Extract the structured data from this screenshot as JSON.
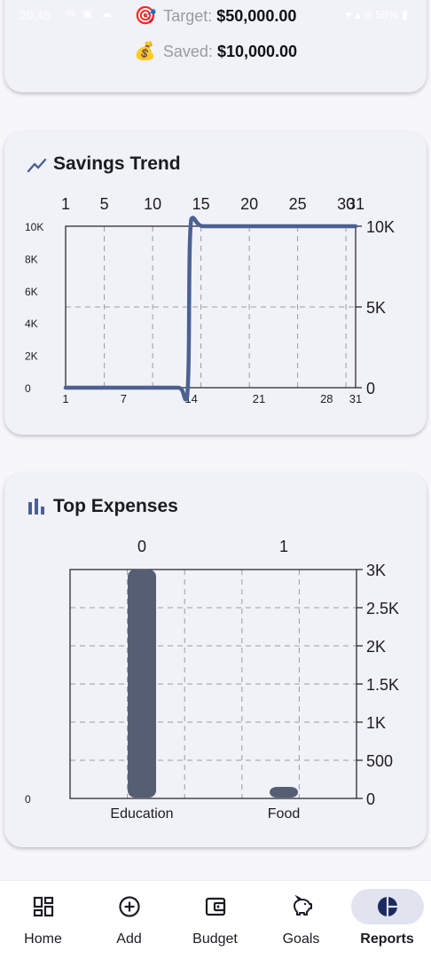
{
  "status_bar": {
    "time": "20:45",
    "battery": "59%"
  },
  "goal": {
    "target_label": "Target:",
    "target_value": "$50,000.00",
    "saved_label": "Saved:",
    "saved_value": "$10,000.00",
    "target_emoji": "🎯",
    "saved_emoji": "💰"
  },
  "savings_trend": {
    "title": "Savings Trend",
    "icon": "trending-up-icon",
    "accent": "#4a6192",
    "chart_data": {
      "type": "line",
      "x_top_ticks": [
        "1",
        "5",
        "10",
        "15",
        "20",
        "25",
        "30",
        "31"
      ],
      "x_bottom_ticks": [
        "1",
        "7",
        "14",
        "21",
        "28",
        "31"
      ],
      "y_left_ticks": [
        "0",
        "2K",
        "4K",
        "6K",
        "8K",
        "10K"
      ],
      "y_right_ticks": [
        "0",
        "5K",
        "10K"
      ],
      "xlim": [
        1,
        31
      ],
      "ylim": [
        0,
        10000
      ],
      "series": [
        {
          "x": [
            1,
            13,
            14,
            31
          ],
          "y": [
            0,
            0,
            10000,
            10000
          ]
        }
      ],
      "grid": true
    }
  },
  "top_expenses": {
    "title": "Top Expenses",
    "icon": "bar-chart-icon",
    "bar_color": "#565e73",
    "chart_data": {
      "type": "bar",
      "categories": [
        "Education",
        "Food"
      ],
      "top_labels": [
        "0",
        "1"
      ],
      "values": [
        3000,
        80
      ],
      "y_right_ticks": [
        "0",
        "500",
        "1K",
        "1.5K",
        "2K",
        "2.5K",
        "3K"
      ],
      "y_left_ticks": [
        "0"
      ],
      "ylim": [
        0,
        3000
      ],
      "grid": true
    }
  },
  "nav": {
    "items": [
      {
        "label": "Home",
        "icon": "dashboard-icon"
      },
      {
        "label": "Add",
        "icon": "add-circle-icon"
      },
      {
        "label": "Budget",
        "icon": "wallet-icon"
      },
      {
        "label": "Goals",
        "icon": "piggy-bank-icon"
      },
      {
        "label": "Reports",
        "icon": "pie-chart-icon"
      }
    ],
    "active": "Reports"
  }
}
